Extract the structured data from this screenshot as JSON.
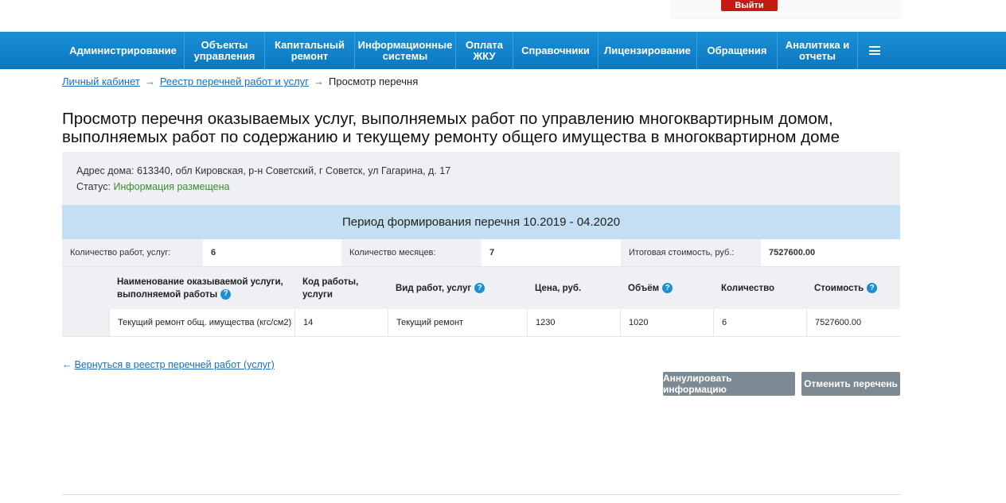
{
  "header": {
    "logout_label": "Выйти"
  },
  "nav": {
    "items": [
      {
        "label": "Администрирование",
        "width": 153
      },
      {
        "label": "Объекты\nуправления",
        "width": 101
      },
      {
        "label": "Капитальный\nремонт",
        "width": 113
      },
      {
        "label": "Информационные\nсистемы",
        "width": 127
      },
      {
        "label": "Оплата\nЖКУ",
        "width": 72
      },
      {
        "label": "Справочники",
        "width": 107
      },
      {
        "label": "Лицензирование",
        "width": 124
      },
      {
        "label": "Обращения",
        "width": 101
      },
      {
        "label": "Аналитика и\nотчеты",
        "width": 101
      }
    ],
    "menu_icon": "hamburger-icon"
  },
  "breadcrumb": {
    "items": [
      "Личный кабинет",
      "Реестр перечней работ и услуг"
    ],
    "separator": "→",
    "current": "Просмотр перечня"
  },
  "page": {
    "title": "Просмотр перечня оказываемых услуг, выполняемых работ по управлению многоквартирным домом, выполняемых работ по содержанию и текущему ремонту общего имущества в многоквартирном доме"
  },
  "info": {
    "address_label": "Адрес дома: ",
    "address": "613340, обл Кировская, р-н Советский, г Советск, ул Гагарина, д. 17",
    "status_label": "Статус: ",
    "status": "Информация размещена",
    "status_color": "#3d8a2f"
  },
  "period": {
    "text": "Период формирования перечня 10.2019 - 04.2020"
  },
  "summary": {
    "works_label": "Количество работ, услуг:",
    "works_value": "6",
    "months_label": "Количество месяцев:",
    "months_value": "7",
    "total_label": "Итоговая стоимость, руб.:",
    "total_value": "7527600.00"
  },
  "table": {
    "headers": {
      "name": "Наименование оказываемой услуги, выполняемой работы",
      "code": "Код работы, услуги",
      "type": "Вид работ, услуг",
      "price": "Цена, руб.",
      "volume": "Объём",
      "quantity": "Количество",
      "cost": "Стоимость"
    },
    "rows": [
      {
        "name": "Текущий ремонт общ. имущества (кгс/см2)",
        "code": "14",
        "type": "Текущий ремонт",
        "price": "1230",
        "volume": "1020",
        "quantity": "6",
        "cost": "7527600.00"
      }
    ]
  },
  "actions": {
    "back_arrow": "←",
    "back_link": "Вернуться в реестр перечней работ (услуг)",
    "annul_button": "Аннулировать информацию",
    "cancel_button": "Отменить перечень"
  },
  "colors": {
    "nav": "#1282c9",
    "link": "#1a6fb8",
    "button": "#7d8a93",
    "logout": "#c41b15",
    "period_bg": "#c4dff2"
  }
}
